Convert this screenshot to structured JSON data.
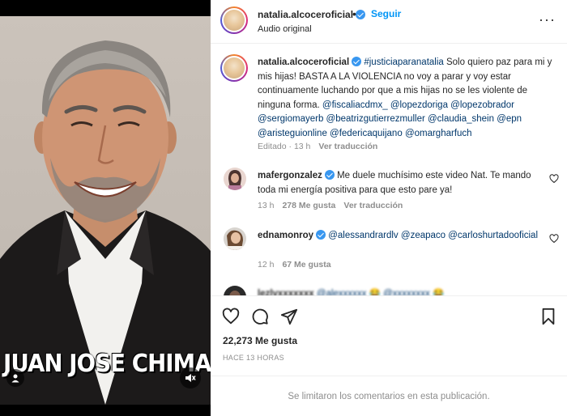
{
  "media": {
    "caption_overlay": "JUAN JOSE CHIMAL"
  },
  "header": {
    "username": "natalia.alcoceroficial",
    "separator": "•",
    "follow_label": "Seguir",
    "subtitle": "Audio original",
    "more_label": "···"
  },
  "caption": {
    "username": "natalia.alcoceroficial",
    "hashtag": "#justiciaparanatalia",
    "text_1": " Solo quiero paz para mi y mis hijas! BASTA A LA VIOLENCIA no voy a parar y voy estar continuamente luchando por que a mis hijas no se les violente de ninguna forma. ",
    "mentions": [
      "@fiscaliacdmx_",
      "@lopezdoriga",
      "@lopezobrador",
      "@sergiomayerb",
      "@beatrizgutierrezmuller",
      "@claudia_shein",
      "@epn",
      "@aristeguionline",
      "@federicaquijano",
      "@omargharfuch"
    ],
    "meta_time": "Editado · 13 h",
    "meta_translate": "Ver traducción"
  },
  "comments": [
    {
      "username": "mafergonzalez",
      "text": " Me duele muchísimo este video Nat. Te mando toda mi energía positiva para que esto pare ya!",
      "time": "13 h",
      "likes": "278 Me gusta",
      "translate": "Ver traducción"
    },
    {
      "username": "ednamonroy",
      "mentions": [
        "@alessandrardlv",
        "@zeapaco",
        "@carloshurtadooficial"
      ],
      "time": "12 h",
      "likes": "67 Me gusta"
    },
    {
      "username": "lezlyxxxxxxx",
      "text": "@alexxxxxx 😂 @xxxxxxxx 😂"
    }
  ],
  "actions": {
    "likes_count": "22,273 Me gusta",
    "time_ago": "HACE 13 HORAS"
  },
  "footer": {
    "comments_limited": "Se limitaron los comentarios en esta publicación."
  },
  "colors": {
    "link_blue": "#0095f6",
    "mention_blue": "#00376b",
    "muted_gray": "#8e8e8e",
    "verified_blue": "#3897f0"
  }
}
